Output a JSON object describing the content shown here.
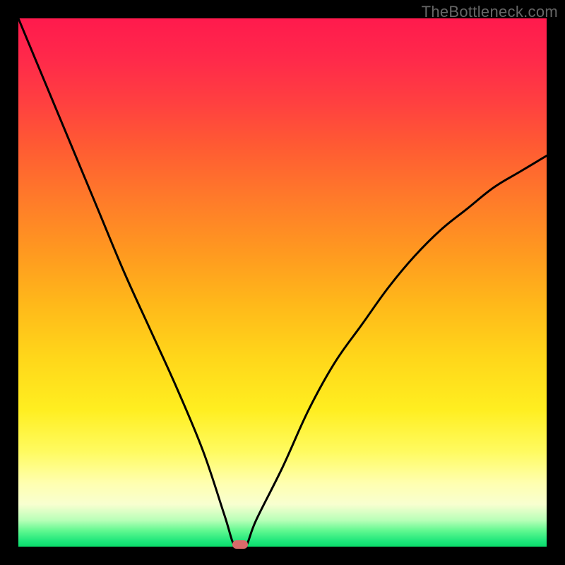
{
  "watermark": "TheBottleneck.com",
  "colors": {
    "background": "#000000",
    "curve": "#000000",
    "marker": "#d96a6a"
  },
  "chart_data": {
    "type": "line",
    "title": "",
    "xlabel": "",
    "ylabel": "",
    "xlim": [
      0,
      100
    ],
    "ylim": [
      0,
      100
    ],
    "series": [
      {
        "name": "bottleneck-curve",
        "x": [
          0,
          5,
          10,
          15,
          20,
          25,
          30,
          35,
          39,
          41,
          43,
          45,
          50,
          55,
          60,
          65,
          70,
          75,
          80,
          85,
          90,
          95,
          100
        ],
        "y": [
          100,
          88,
          76,
          64,
          52,
          41,
          30,
          18,
          6,
          0,
          0,
          5,
          15,
          26,
          35,
          42,
          49,
          55,
          60,
          64,
          68,
          71,
          74
        ]
      }
    ],
    "marker": {
      "x": 42,
      "y": 0
    },
    "gradient_stops": [
      {
        "pos": 0.0,
        "value": 100,
        "color": "#ff1a4d"
      },
      {
        "pos": 0.5,
        "value": 50,
        "color": "#ffb81a"
      },
      {
        "pos": 0.9,
        "value": 10,
        "color": "#ffffb0"
      },
      {
        "pos": 1.0,
        "value": 0,
        "color": "#0adc6a"
      }
    ]
  }
}
